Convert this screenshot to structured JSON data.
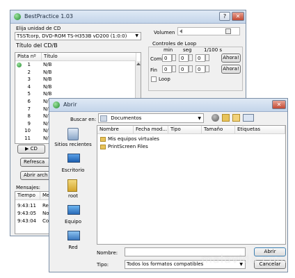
{
  "main": {
    "title": "BestPractice 1.03",
    "help_btn": "?",
    "close_btn": "✕",
    "cd_label": "Elija unidad de CD",
    "cd_value": "TSSTcorp, DVD-ROM TS-H353B vD200 (1:0:0)",
    "volume_label": "Volumen",
    "tracks_title": "Título del CD",
    "tracks_title_extra": "/B",
    "col_pista": "Pista nº",
    "col_titulo": "Título",
    "tracks": [
      {
        "n": "1",
        "t": "N/B"
      },
      {
        "n": "2",
        "t": "N/B"
      },
      {
        "n": "3",
        "t": "N/B"
      },
      {
        "n": "4",
        "t": "N/B"
      },
      {
        "n": "5",
        "t": "N/B"
      },
      {
        "n": "6",
        "t": "N/"
      },
      {
        "n": "7",
        "t": "N/"
      },
      {
        "n": "8",
        "t": "N/"
      },
      {
        "n": "9",
        "t": "N/"
      },
      {
        "n": "10",
        "t": "N/"
      },
      {
        "n": "11",
        "t": "N/"
      }
    ],
    "loop_title": "Controles de Loop",
    "loop_min": "min",
    "loop_seg": "seg",
    "loop_centi": "1/100 s",
    "loop_start_label": "Comie",
    "loop_end_label": "Fin",
    "zero": "0",
    "ahora": "Ahora!",
    "loop_check": "Loop",
    "cd_btn": "▶ CD",
    "refresh_btn": "Refresca",
    "open_btn": "Abrir arch",
    "messages_label": "Mensajes:",
    "msg_col_time": "Tiempo",
    "msg_col_msg": "Me",
    "messages": [
      {
        "time": "9:43:11",
        "msg": "Re"
      },
      {
        "time": "9:43:05",
        "msg": "No"
      },
      {
        "time": "9:43:04",
        "msg": "Co"
      }
    ]
  },
  "dialog": {
    "title": "Abrir",
    "close_btn": "✕",
    "lookin_label": "Buscar en:",
    "lookin_value": "Documentos",
    "columns": [
      "Nombre",
      "Fecha mod...",
      "Tipo",
      "Tamaño",
      "Etiquetas"
    ],
    "files": [
      {
        "name": "Mis equipos virtuales"
      },
      {
        "name": "PrintScreen Files"
      }
    ],
    "places": [
      {
        "label": "Sitios recientes",
        "icon": "recent-places-icon"
      },
      {
        "label": "Escritorio",
        "icon": "desktop-icon"
      },
      {
        "label": "root",
        "icon": "user-folder-icon"
      },
      {
        "label": "Equipo",
        "icon": "computer-icon"
      },
      {
        "label": "Red",
        "icon": "network-icon"
      }
    ],
    "name_label": "Nombre:",
    "name_value": "",
    "type_label": "Tipo:",
    "type_value": "Todos los formatos compatibles",
    "open_btn": "Abrir",
    "cancel_btn": "Cancelar"
  },
  "watermark": "malavida.com",
  "colors": {
    "accent": "#3399ff",
    "titlebar": "#c4d5ea",
    "close": "#c24a33",
    "folder": "#e8c35a"
  }
}
